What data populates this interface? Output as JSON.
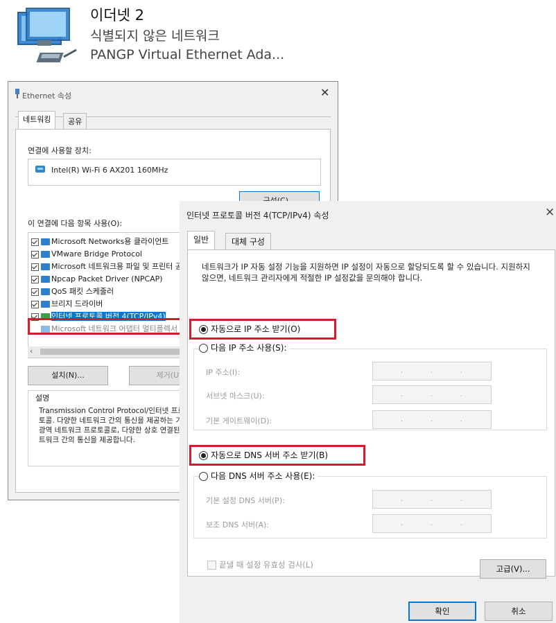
{
  "adapter": {
    "name": "이더넷 2",
    "status": "식별되지 않은 네트워크",
    "device": "PANGP Virtual Ethernet Ada..."
  },
  "ethernet_dialog": {
    "title": "Ethernet 속성",
    "tabs": [
      "네트워킹",
      "공유"
    ],
    "connect_using_label": "연결에 사용할 장치:",
    "device_name": "Intel(R) Wi-Fi 6 AX201 160MHz",
    "configure_button": "구성(C)...",
    "items_label": "이 연결에 다음 항목 사용(O):",
    "items": [
      {
        "label": "Microsoft Networks용 클라이언트",
        "checked": true
      },
      {
        "label": "VMware Bridge Protocol",
        "checked": true
      },
      {
        "label": "Microsoft 네트워크용 파일 및 프린터 공유",
        "checked": true
      },
      {
        "label": "Npcap Packet Driver (NPCAP)",
        "checked": true
      },
      {
        "label": "QoS 패킷 스케줄러",
        "checked": true
      },
      {
        "label": "브리지 드라이버",
        "checked": true
      },
      {
        "label": "인터넷 프로토콜 버전 4(TCP/IPv4)",
        "checked": true,
        "selected": true
      },
      {
        "label": "Microsoft 네트워크 어댑터 멀티플렉서 프로토콜",
        "checked": false
      }
    ],
    "install_button": "설치(N)...",
    "uninstall_button": "제거(U)",
    "description_label": "설명",
    "description_text": "Transmission Control Protocol/인터넷 프로토콜. 다양한 네트워크 간의 통신을 제공하는 기본 광역 네트워크 프로토콜로, 다양한 상호 연결된 네트워크 간의 통신을 제공합니다."
  },
  "ipv4_dialog": {
    "title": "인터넷 프로토콜 버전 4(TCP/IPv4) 속성",
    "close": "×",
    "tabs": [
      "일반",
      "대체 구성"
    ],
    "description": "네트워크가 IP 자동 설정 기능을 지원하면 IP 설정이 자동으로 할당되도록 할 수 있습니다. 지원하지 않으면, 네트워크 관리자에게 적절한 IP 설정값을 문의해야 합니다.",
    "ip_auto": "자동으로 IP 주소 받기(O)",
    "ip_manual": "다음 IP 주소 사용(S):",
    "ip_fields": [
      {
        "label": "IP 주소(I):"
      },
      {
        "label": "서브넷 마스크(U):"
      },
      {
        "label": "기본 게이트웨이(D):"
      }
    ],
    "dns_auto": "자동으로 DNS 서버 주소 받기(B)",
    "dns_manual": "다음 DNS 서버 주소 사용(E):",
    "dns_fields": [
      {
        "label": "기본 설정 DNS 서버(P):"
      },
      {
        "label": "보조 DNS 서버(A):"
      }
    ],
    "validate_label": "끝낼 때 설정 유효성 검사(L)",
    "advanced_button": "고급(V)...",
    "ok_button": "확인",
    "cancel_button": "취소",
    "selected_ip_mode": "auto",
    "selected_dns_mode": "auto",
    "highlight_color": "#cf1f2e",
    "accent_color": "#0078d7"
  }
}
